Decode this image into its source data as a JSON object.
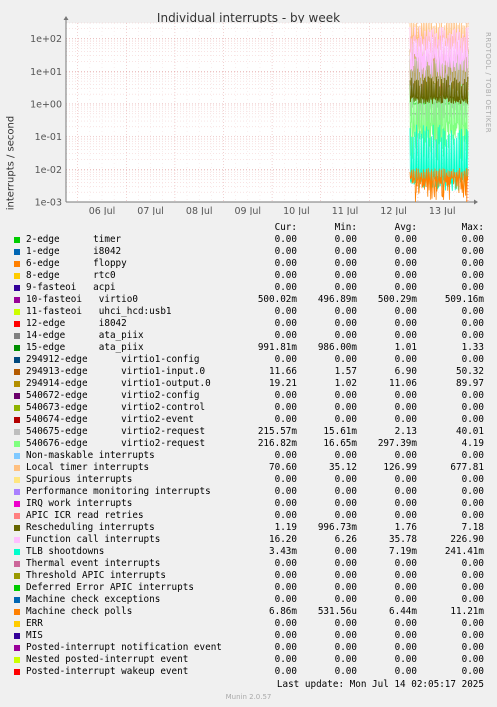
{
  "side_label": "RRDTOOL / TOBI OETIKER",
  "footer": {
    "last_update": "Last update: Mon Jul 14 02:05:17 2025",
    "version": "Munin 2.0.57"
  },
  "legend_headers": {
    "cur": "Cur:",
    "min": "Min:",
    "avg": "Avg:",
    "max": "Max:"
  },
  "chart_data": {
    "type": "line",
    "title": "Individual interrupts - by week",
    "ylabel": "interrupts / second",
    "yscale": "log",
    "ylim": [
      0.001,
      300
    ],
    "y_ticks": [
      "1e-03",
      "1e-02",
      "1e-01",
      "1e+00",
      "1e+01",
      "1e+02"
    ],
    "x_ticks": [
      "06 Jul",
      "07 Jul",
      "08 Jul",
      "09 Jul",
      "10 Jul",
      "11 Jul",
      "12 Jul",
      "13 Jul"
    ],
    "series": [
      {
        "name": "2-edge      timer",
        "color": "#00cc00",
        "cur": "0.00",
        "min": "0.00",
        "avg": "0.00",
        "max": "0.00"
      },
      {
        "name": "1-edge      i8042",
        "color": "#0066b3",
        "cur": "0.00",
        "min": "0.00",
        "avg": "0.00",
        "max": "0.00"
      },
      {
        "name": "6-edge      floppy",
        "color": "#ff8000",
        "cur": "0.00",
        "min": "0.00",
        "avg": "0.00",
        "max": "0.00"
      },
      {
        "name": "8-edge      rtc0",
        "color": "#ffcc00",
        "cur": "0.00",
        "min": "0.00",
        "avg": "0.00",
        "max": "0.00"
      },
      {
        "name": "9-fasteoi   acpi",
        "color": "#330099",
        "cur": "0.00",
        "min": "0.00",
        "avg": "0.00",
        "max": "0.00"
      },
      {
        "name": "10-fasteoi   virtio0",
        "color": "#990099",
        "cur": "500.02m",
        "min": "496.89m",
        "avg": "500.29m",
        "max": "509.16m"
      },
      {
        "name": "11-fasteoi   uhci_hcd:usb1",
        "color": "#ccff00",
        "cur": "0.00",
        "min": "0.00",
        "avg": "0.00",
        "max": "0.00"
      },
      {
        "name": "12-edge      i8042",
        "color": "#ff0000",
        "cur": "0.00",
        "min": "0.00",
        "avg": "0.00",
        "max": "0.00"
      },
      {
        "name": "14-edge      ata_piix",
        "color": "#808080",
        "cur": "0.00",
        "min": "0.00",
        "avg": "0.00",
        "max": "0.00"
      },
      {
        "name": "15-edge      ata_piix",
        "color": "#008f00",
        "cur": "991.81m",
        "min": "986.00m",
        "avg": "1.01",
        "max": "1.33"
      },
      {
        "name": "294912-edge      virtio1-config",
        "color": "#00487d",
        "cur": "0.00",
        "min": "0.00",
        "avg": "0.00",
        "max": "0.00"
      },
      {
        "name": "294913-edge      virtio1-input.0",
        "color": "#b35a00",
        "cur": "11.66",
        "min": "1.57",
        "avg": "6.90",
        "max": "50.32"
      },
      {
        "name": "294914-edge      virtio1-output.0",
        "color": "#b38f00",
        "cur": "19.21",
        "min": "1.02",
        "avg": "11.06",
        "max": "89.97"
      },
      {
        "name": "540672-edge      virtio2-config",
        "color": "#6b006b",
        "cur": "0.00",
        "min": "0.00",
        "avg": "0.00",
        "max": "0.00"
      },
      {
        "name": "540673-edge      virtio2-control",
        "color": "#8fb300",
        "cur": "0.00",
        "min": "0.00",
        "avg": "0.00",
        "max": "0.00"
      },
      {
        "name": "540674-edge      virtio2-event",
        "color": "#b30000",
        "cur": "0.00",
        "min": "0.00",
        "avg": "0.00",
        "max": "0.00"
      },
      {
        "name": "540675-edge      virtio2-request",
        "color": "#bebebe",
        "cur": "215.57m",
        "min": "15.61m",
        "avg": "2.13",
        "max": "40.01"
      },
      {
        "name": "540676-edge      virtio2-request",
        "color": "#80ff80",
        "cur": "216.82m",
        "min": "16.65m",
        "avg": "297.39m",
        "max": "4.19"
      },
      {
        "name": "Non-maskable interrupts",
        "color": "#80c9ff",
        "cur": "0.00",
        "min": "0.00",
        "avg": "0.00",
        "max": "0.00"
      },
      {
        "name": "Local timer interrupts",
        "color": "#ffc080",
        "cur": "70.60",
        "min": "35.12",
        "avg": "126.99",
        "max": "677.81"
      },
      {
        "name": "Spurious interrupts",
        "color": "#ffe680",
        "cur": "0.00",
        "min": "0.00",
        "avg": "0.00",
        "max": "0.00"
      },
      {
        "name": "Performance monitoring interrupts",
        "color": "#aa80ff",
        "cur": "0.00",
        "min": "0.00",
        "avg": "0.00",
        "max": "0.00"
      },
      {
        "name": "IRQ work interrupts",
        "color": "#ee00cc",
        "cur": "0.00",
        "min": "0.00",
        "avg": "0.00",
        "max": "0.00"
      },
      {
        "name": "APIC ICR read retries",
        "color": "#ff8080",
        "cur": "0.00",
        "min": "0.00",
        "avg": "0.00",
        "max": "0.00"
      },
      {
        "name": "Rescheduling interrupts",
        "color": "#666600",
        "cur": "1.19",
        "min": "996.73m",
        "avg": "1.76",
        "max": "7.18"
      },
      {
        "name": "Function call interrupts",
        "color": "#ffbfff",
        "cur": "16.20",
        "min": "6.26",
        "avg": "35.78",
        "max": "226.90"
      },
      {
        "name": "TLB shootdowns",
        "color": "#00ffcc",
        "cur": "3.43m",
        "min": "0.00",
        "avg": "7.19m",
        "max": "241.41m"
      },
      {
        "name": "Thermal event interrupts",
        "color": "#cc6699",
        "cur": "0.00",
        "min": "0.00",
        "avg": "0.00",
        "max": "0.00"
      },
      {
        "name": "Threshold APIC interrupts",
        "color": "#999900",
        "cur": "0.00",
        "min": "0.00",
        "avg": "0.00",
        "max": "0.00"
      },
      {
        "name": "Deferred Error APIC interrupts",
        "color": "#00cc00",
        "cur": "0.00",
        "min": "0.00",
        "avg": "0.00",
        "max": "0.00"
      },
      {
        "name": "Machine check exceptions",
        "color": "#0066b3",
        "cur": "0.00",
        "min": "0.00",
        "avg": "0.00",
        "max": "0.00"
      },
      {
        "name": "Machine check polls",
        "color": "#ff8000",
        "cur": "6.86m",
        "min": "531.56u",
        "avg": "6.44m",
        "max": "11.21m"
      },
      {
        "name": "ERR",
        "color": "#ffcc00",
        "cur": "0.00",
        "min": "0.00",
        "avg": "0.00",
        "max": "0.00"
      },
      {
        "name": "MIS",
        "color": "#330099",
        "cur": "0.00",
        "min": "0.00",
        "avg": "0.00",
        "max": "0.00"
      },
      {
        "name": "Posted-interrupt notification event",
        "color": "#990099",
        "cur": "0.00",
        "min": "0.00",
        "avg": "0.00",
        "max": "0.00"
      },
      {
        "name": "Nested posted-interrupt event",
        "color": "#ccff00",
        "cur": "0.00",
        "min": "0.00",
        "avg": "0.00",
        "max": "0.00"
      },
      {
        "name": "Posted-interrupt wakeup event",
        "color": "#ff0000",
        "cur": "0.00",
        "min": "0.00",
        "avg": "0.00",
        "max": "0.00"
      }
    ]
  }
}
